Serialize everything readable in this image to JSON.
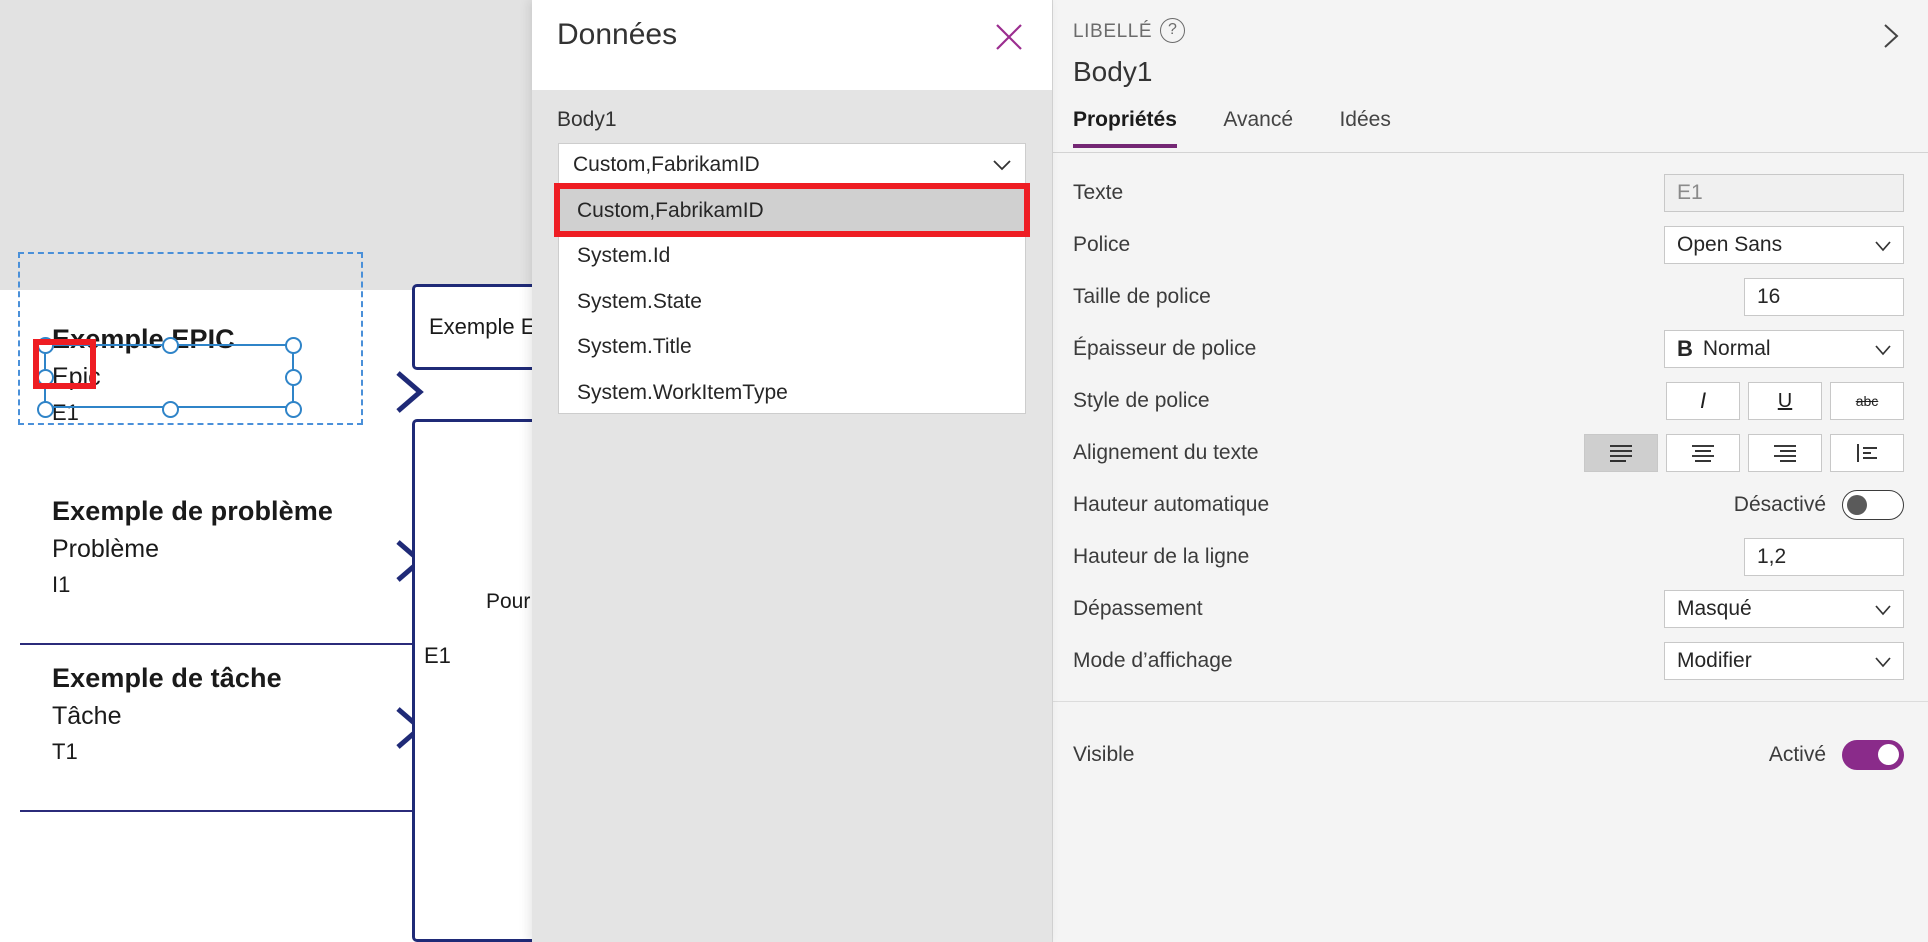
{
  "canvas": {
    "cards": [
      {
        "title": "Exemple EPIC",
        "subtitle": "Epic",
        "id": "E1",
        "chevron_icon": "chevron-right-icon"
      },
      {
        "title": "Exemple de problème",
        "subtitle": "Problème",
        "id": "I1",
        "chevron_icon": "chevron-right-icon"
      },
      {
        "title": "Exemple de tâche",
        "subtitle": "Tâche",
        "id": "T1",
        "chevron_icon": "chevron-right-icon"
      }
    ],
    "outline_boxes": [
      {
        "text": "Exemple EPIC"
      },
      {
        "text": ""
      }
    ],
    "box_labels": {
      "pour": "Pour",
      "e1": "E1"
    },
    "selection": {
      "selected_element": "E1",
      "accent": "#2f84c8",
      "frame_color": "#4a90d9"
    },
    "annotation_color": "#ee1d23"
  },
  "data_panel": {
    "title": "Données",
    "close_icon": "close-icon",
    "field_label": "Body1",
    "select": {
      "value": "Custom,FabrikamID",
      "caret_icon": "chevron-down-icon"
    },
    "options": [
      "Custom,FabrikamID",
      "System.Id",
      "System.State",
      "System.Title",
      "System.WorkItemType"
    ],
    "highlighted_option_index": 0
  },
  "properties": {
    "kicker": "LIBELLÉ",
    "help_icon": "help-circle-icon",
    "expand_icon": "chevron-right-icon",
    "name": "Body1",
    "tabs": [
      {
        "label": "Propriétés",
        "active": true
      },
      {
        "label": "Avancé",
        "active": false
      },
      {
        "label": "Idées",
        "active": false
      }
    ],
    "accent": "#742774",
    "rows": {
      "texte": {
        "label": "Texte",
        "value": "E1"
      },
      "police": {
        "label": "Police",
        "value": "Open Sans",
        "caret_icon": "chevron-down-icon"
      },
      "taille": {
        "label": "Taille de police",
        "value": "16"
      },
      "epaisseur": {
        "label": "Épaisseur de police",
        "value": "Normal",
        "prefix": "B",
        "caret_icon": "chevron-down-icon"
      },
      "style": {
        "label": "Style de police",
        "buttons": [
          {
            "glyph": "I",
            "icon": "italic-icon",
            "active": false
          },
          {
            "glyph": "U",
            "icon": "underline-icon",
            "active": false
          },
          {
            "glyph": "abc",
            "icon": "strikethrough-icon",
            "active": false
          }
        ]
      },
      "alignement": {
        "label": "Alignement du texte",
        "buttons": [
          {
            "icon": "align-left-icon",
            "active": true
          },
          {
            "icon": "align-center-icon",
            "active": false
          },
          {
            "icon": "align-right-icon",
            "active": false
          },
          {
            "icon": "align-justify-icon",
            "active": false
          }
        ]
      },
      "hauteur_auto": {
        "label": "Hauteur automatique",
        "state_text": "Désactivé",
        "on": false
      },
      "hauteur_ligne": {
        "label": "Hauteur de la ligne",
        "value": "1,2"
      },
      "depassement": {
        "label": "Dépassement",
        "value": "Masqué",
        "caret_icon": "chevron-down-icon"
      },
      "mode_affichage": {
        "label": "Mode d’affichage",
        "value": "Modifier",
        "caret_icon": "chevron-down-icon"
      },
      "visible": {
        "label": "Visible",
        "state_text": "Activé",
        "on": true
      }
    }
  }
}
